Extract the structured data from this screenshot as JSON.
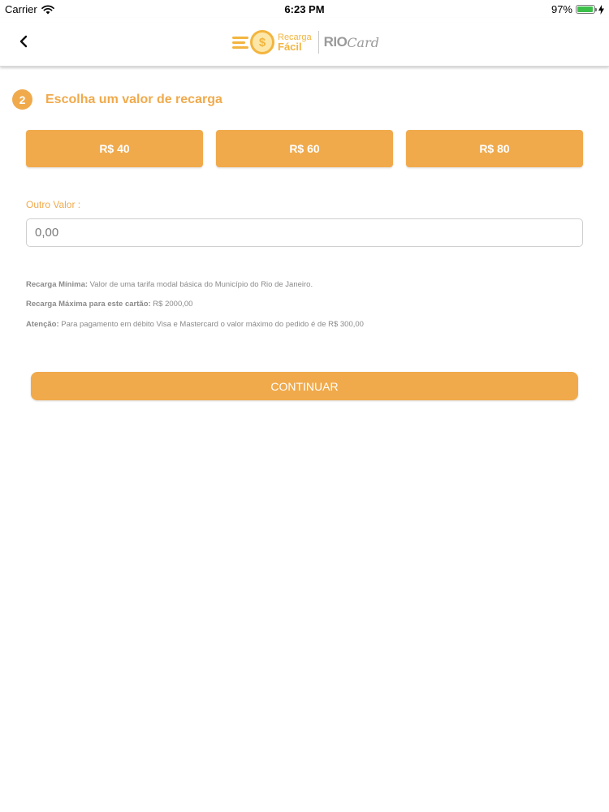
{
  "status_bar": {
    "carrier": "Carrier",
    "time": "6:23 PM",
    "battery_percent": "97%",
    "battery_level": 0.97,
    "icons": [
      "wifi-icon",
      "battery-icon",
      "charging-icon"
    ]
  },
  "nav": {
    "back_icon": "chevron-left-icon",
    "logo": {
      "line1": "Recarga",
      "line2": "Fácil",
      "brand_rio": "RIO",
      "brand_card": "Card"
    }
  },
  "step": {
    "number": "2",
    "title": "Escolha um valor de recarga"
  },
  "amounts": [
    {
      "label": "R$ 40"
    },
    {
      "label": "R$ 60"
    },
    {
      "label": "R$ 80"
    }
  ],
  "other_value": {
    "label": "Outro Valor :",
    "placeholder": "0,00"
  },
  "info": [
    {
      "bold": "Recarga Mínima:",
      "text": " Valor de uma tarifa modal básica do Município do Rio de Janeiro."
    },
    {
      "bold": "Recarga Máxima para este cartão:",
      "text": " R$ 2000,00"
    },
    {
      "bold": "Atenção:",
      "text": " Para pagamento em débito Visa e Mastercard o valor máximo do pedido é de R$ 300,00"
    }
  ],
  "continue_label": "CONTINUAR",
  "colors": {
    "accent": "#f0aa4c",
    "logo_yellow": "#f3b53f",
    "battery_green": "#3cc04a"
  }
}
